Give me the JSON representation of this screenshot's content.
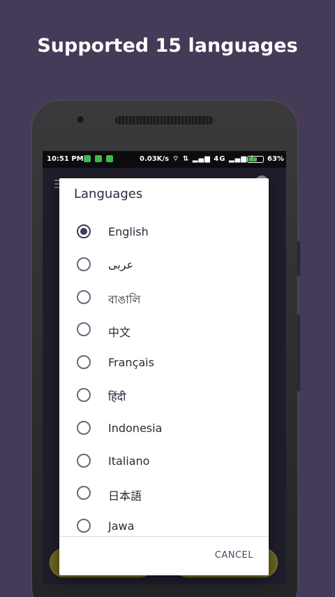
{
  "headline": "Supported 15 languages",
  "status_bar": {
    "time": "10:51 PM",
    "net_speed": "0.03K/s",
    "network": "4G",
    "battery_percent": "63%",
    "battery_level": 0.63
  },
  "dialog": {
    "title": "Languages",
    "selected_index": 0,
    "options": [
      {
        "label": "English",
        "checked": true
      },
      {
        "label": "عربى",
        "checked": false
      },
      {
        "label": "বাঙালি",
        "checked": false
      },
      {
        "label": "中文",
        "checked": false
      },
      {
        "label": "Français",
        "checked": false
      },
      {
        "label": "हिंदी",
        "checked": false
      },
      {
        "label": "Indonesia",
        "checked": false
      },
      {
        "label": "Italiano",
        "checked": false
      },
      {
        "label": "日本語",
        "checked": false
      },
      {
        "label": "Jawa",
        "checked": false
      }
    ],
    "cancel_label": "CANCEL"
  },
  "colors": {
    "background": "#453a57",
    "accent": "#413a5a",
    "dialog_bg": "#ffffff"
  }
}
